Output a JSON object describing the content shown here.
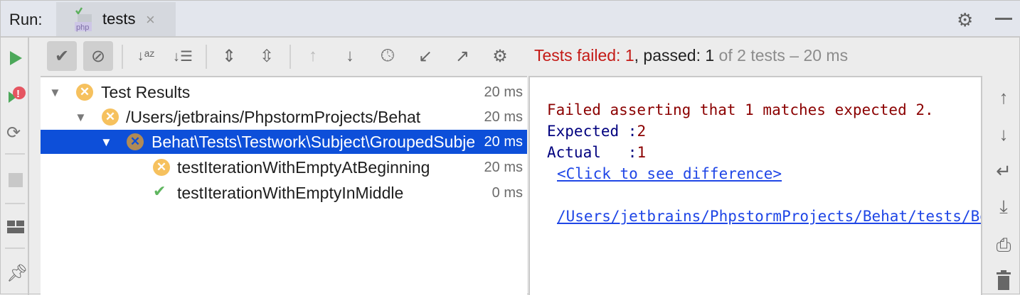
{
  "header": {
    "run_label": "Run:",
    "tab": {
      "name": "tests",
      "icon_text": "php",
      "close": "×"
    }
  },
  "toolbar": {
    "status": {
      "failed": "Tests failed: 1",
      "passed": ", passed: 1",
      "total": " of 2 tests – 20 ms"
    }
  },
  "tree": [
    {
      "label": "Test Results",
      "time": "20 ms",
      "status": "failed",
      "level": 0
    },
    {
      "label": "/Users/jetbrains/PhpstormProjects/Behat",
      "time": "20 ms",
      "status": "failed",
      "level": 1
    },
    {
      "label": "Behat\\Tests\\Testwork\\Subject\\GroupedSubjectIteratorTest",
      "time": "20 ms",
      "status": "failed",
      "level": 2,
      "selected": true
    },
    {
      "label": "testIterationWithEmptyAtBeginning",
      "time": "20 ms",
      "status": "failed",
      "level": 3
    },
    {
      "label": "testIterationWithEmptyInMiddle",
      "time": "0 ms",
      "status": "passed",
      "level": 3
    }
  ],
  "console": {
    "message": "Failed asserting that 1 matches expected 2.",
    "expected_label": "Expected :",
    "expected_value": "2",
    "actual_label": "Actual   :",
    "actual_value": "1",
    "diff_link": "<Click to see difference>",
    "path_link": "/Users/jetbrains/PhpstormProjects/Behat/tests/Behat/Tests/Testwork/Subject/GroupedSubjectIteratorTest.php"
  },
  "colors": {
    "failed": "#c41a16",
    "selected": "#0d4fd9",
    "run": "#4ca85a"
  }
}
